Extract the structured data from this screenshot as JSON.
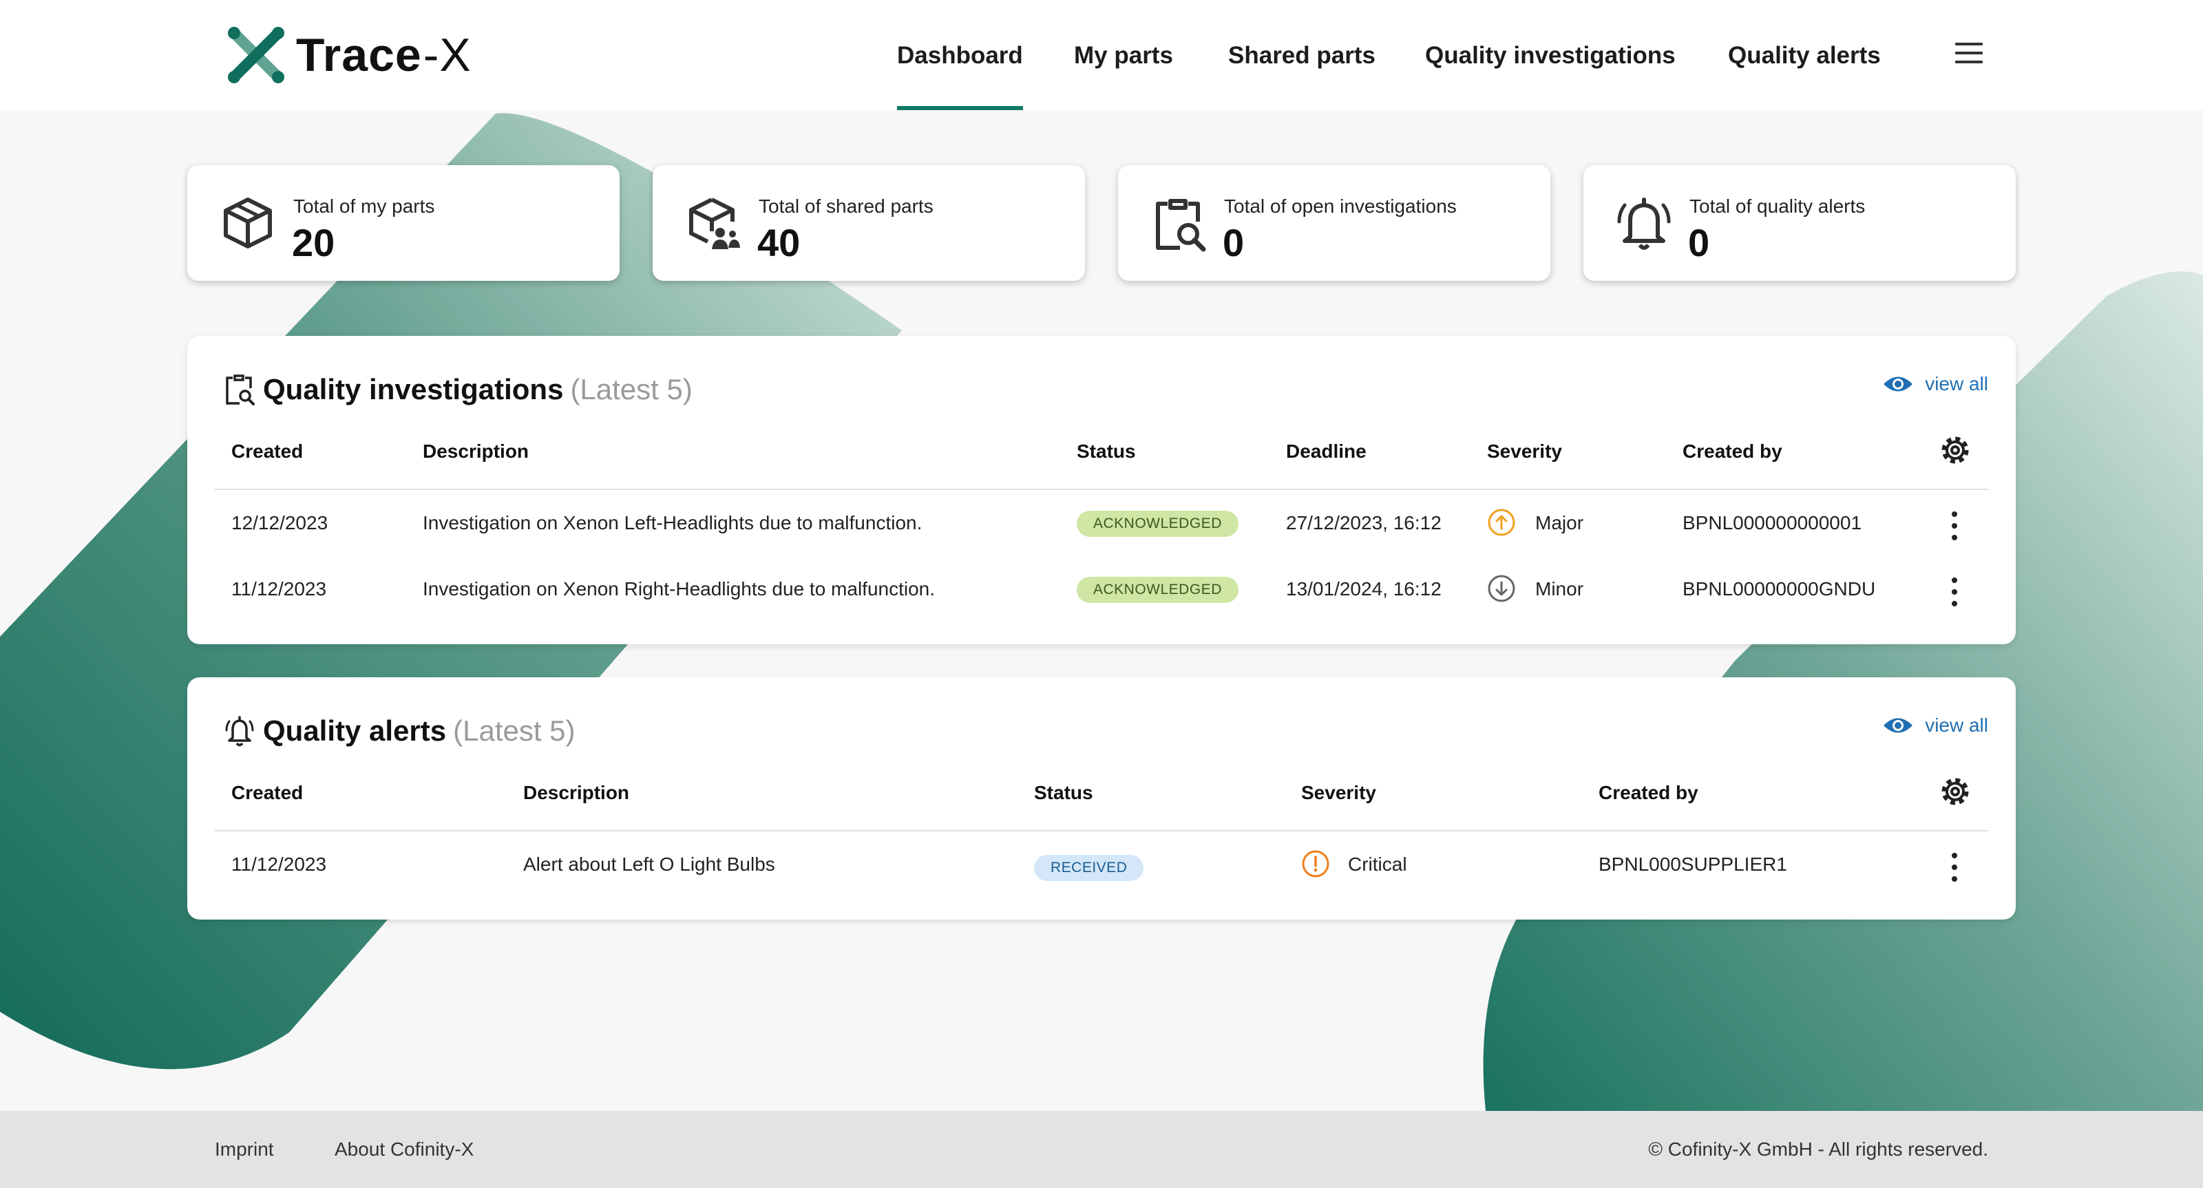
{
  "app": {
    "logo_bold": "Trace",
    "logo_thin": "-X"
  },
  "nav": {
    "items": [
      {
        "label": "Dashboard",
        "active": true
      },
      {
        "label": "My parts"
      },
      {
        "label": "Shared parts"
      },
      {
        "label": "Quality investigations"
      },
      {
        "label": "Quality alerts"
      }
    ],
    "menu_icon": "hamburger-icon"
  },
  "stats": [
    {
      "label": "Total of my parts",
      "value": "20",
      "icon": "cube-icon"
    },
    {
      "label": "Total of shared parts",
      "value": "40",
      "icon": "shared-cube-icon"
    },
    {
      "label": "Total of open investigations",
      "value": "0",
      "icon": "clipboard-search-icon"
    },
    {
      "label": "Total of quality alerts",
      "value": "0",
      "icon": "bell-alert-icon"
    }
  ],
  "investigations": {
    "title": "Quality investigations",
    "subtitle": "(Latest 5)",
    "view_all": "view all",
    "columns": [
      "Created",
      "Description",
      "Status",
      "Deadline",
      "Severity",
      "Created by"
    ],
    "rows": [
      {
        "created": "12/12/2023",
        "description": "Investigation on Xenon Left-Headlights due to malfunction.",
        "status": "ACKNOWLEDGED",
        "deadline": "27/12/2023, 16:12",
        "severity": "Major",
        "created_by": "BPNL000000000001"
      },
      {
        "created": "11/12/2023",
        "description": "Investigation on Xenon Right-Headlights due to malfunction.",
        "status": "ACKNOWLEDGED",
        "deadline": "13/01/2024, 16:12",
        "severity": "Minor",
        "created_by": "BPNL00000000GNDU"
      }
    ]
  },
  "alerts": {
    "title": "Quality alerts",
    "subtitle": "(Latest 5)",
    "view_all": "view all",
    "columns": [
      "Created",
      "Description",
      "Status",
      "Severity",
      "Created by"
    ],
    "rows": [
      {
        "created": "11/12/2023",
        "description": "Alert about Left O Light Bulbs",
        "status": "RECEIVED",
        "severity": "Critical",
        "created_by": "BPNL000SUPPLIER1"
      }
    ]
  },
  "footer": {
    "links": [
      "Imprint",
      "About Cofinity-X"
    ],
    "copyright": "© Cofinity-X GmbH - All rights reserved."
  },
  "colors": {
    "accent": "#0f7a66",
    "major": "#f0a020",
    "critical": "#ee7f1c",
    "link": "#1f6fb3",
    "acknowledged_bg": "#cfe6a4",
    "received_bg": "#d3e7f8"
  }
}
